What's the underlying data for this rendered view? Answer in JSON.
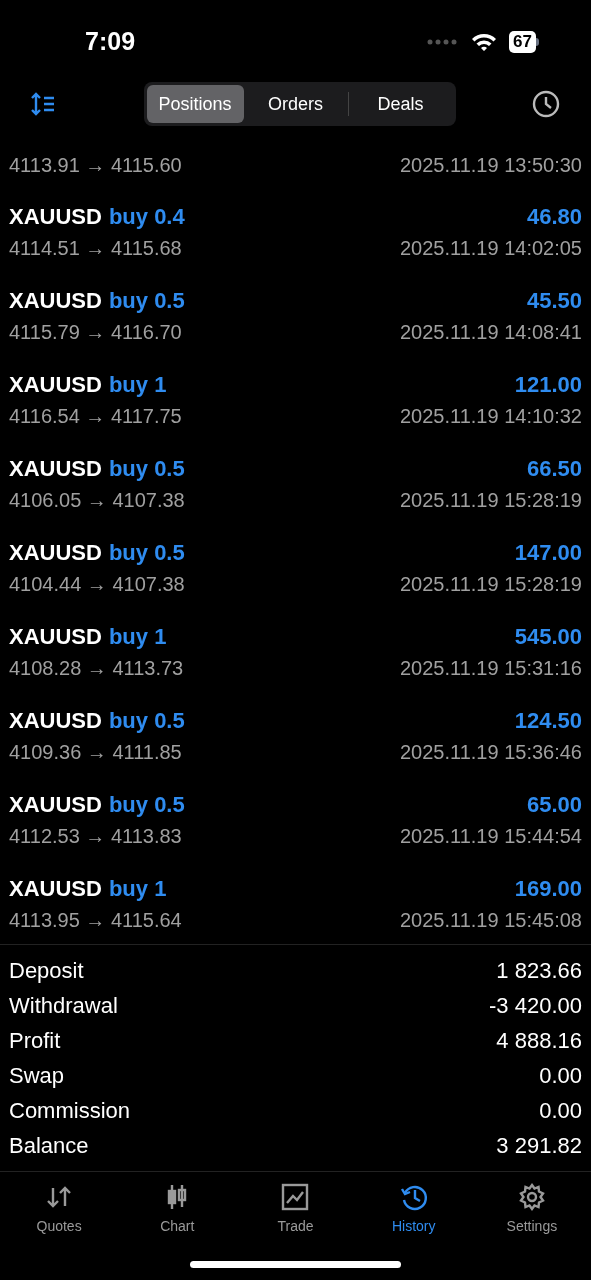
{
  "status_bar": {
    "time": "7:09",
    "battery": "67"
  },
  "segments": [
    {
      "label": "Positions",
      "selected": true
    },
    {
      "label": "Orders",
      "selected": false
    },
    {
      "label": "Deals",
      "selected": false
    }
  ],
  "trades": [
    {
      "prices": "4113.91 → 4115.60",
      "time": "2025.11.19 13:50:30"
    },
    {
      "symbol": "XAUUSD",
      "side": "buy 0.4",
      "profit": "46.80",
      "prices": "4114.51 → 4115.68",
      "time": "2025.11.19 14:02:05"
    },
    {
      "symbol": "XAUUSD",
      "side": "buy 0.5",
      "profit": "45.50",
      "prices": "4115.79 → 4116.70",
      "time": "2025.11.19 14:08:41"
    },
    {
      "symbol": "XAUUSD",
      "side": "buy 1",
      "profit": "121.00",
      "prices": "4116.54 → 4117.75",
      "time": "2025.11.19 14:10:32"
    },
    {
      "symbol": "XAUUSD",
      "side": "buy 0.5",
      "profit": "66.50",
      "prices": "4106.05 → 4107.38",
      "time": "2025.11.19 15:28:19"
    },
    {
      "symbol": "XAUUSD",
      "side": "buy 0.5",
      "profit": "147.00",
      "prices": "4104.44 → 4107.38",
      "time": "2025.11.19 15:28:19"
    },
    {
      "symbol": "XAUUSD",
      "side": "buy 1",
      "profit": "545.00",
      "prices": "4108.28 → 4113.73",
      "time": "2025.11.19 15:31:16"
    },
    {
      "symbol": "XAUUSD",
      "side": "buy 0.5",
      "profit": "124.50",
      "prices": "4109.36 → 4111.85",
      "time": "2025.11.19 15:36:46"
    },
    {
      "symbol": "XAUUSD",
      "side": "buy 0.5",
      "profit": "65.00",
      "prices": "4112.53 → 4113.83",
      "time": "2025.11.19 15:44:54"
    },
    {
      "symbol": "XAUUSD",
      "side": "buy 1",
      "profit": "169.00",
      "prices": "4113.95 → 4115.64",
      "time": "2025.11.19 15:45:08"
    }
  ],
  "summary": [
    {
      "label": "Deposit",
      "value": "1 823.66"
    },
    {
      "label": "Withdrawal",
      "value": "-3 420.00"
    },
    {
      "label": "Profit",
      "value": "4 888.16"
    },
    {
      "label": "Swap",
      "value": "0.00"
    },
    {
      "label": "Commission",
      "value": "0.00"
    },
    {
      "label": "Balance",
      "value": "3 291.82"
    }
  ],
  "tab_bar": [
    {
      "kind": "quotes",
      "label": "Quotes",
      "selected": false
    },
    {
      "kind": "chart",
      "label": "Chart",
      "selected": false
    },
    {
      "kind": "trade",
      "label": "Trade",
      "selected": false
    },
    {
      "kind": "history",
      "label": "History",
      "selected": true
    },
    {
      "kind": "settings",
      "label": "Settings",
      "selected": false
    }
  ]
}
